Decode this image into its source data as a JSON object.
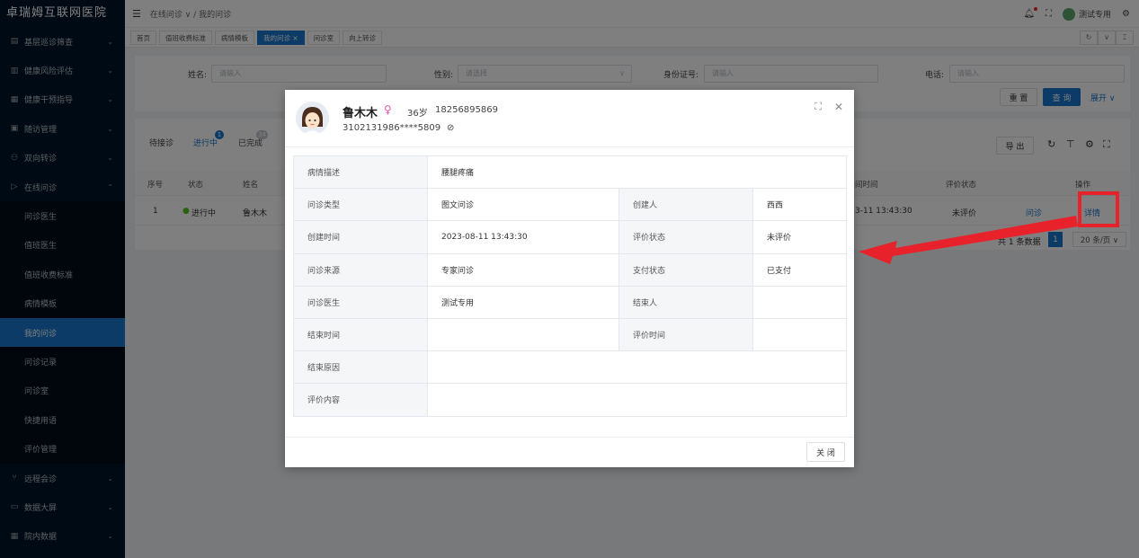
{
  "app": {
    "title": "卓瑞姆互联网医院"
  },
  "sidebar": {
    "items": [
      {
        "icon": "clipboard-icon",
        "glyph": "▤",
        "label": "基层巡诊筛查",
        "chevron": "⌄"
      },
      {
        "icon": "report-icon",
        "glyph": "▥",
        "label": "健康风险评估",
        "chevron": "⌄"
      },
      {
        "icon": "list-icon",
        "glyph": "▦",
        "label": "健康干预指导",
        "chevron": "⌄"
      },
      {
        "icon": "calendar-icon",
        "glyph": "▣",
        "label": "随访管理",
        "chevron": "⌄"
      },
      {
        "icon": "users-icon",
        "glyph": "⚇",
        "label": "双向转诊",
        "chevron": "⌄"
      },
      {
        "icon": "play-icon",
        "glyph": "▷",
        "label": "在线问诊",
        "chevron": "⌃"
      }
    ],
    "subitems": [
      "问诊医生",
      "值班医生",
      "值班收费标准",
      "病情模板",
      "我的问诊",
      "问诊记录",
      "问诊室",
      "快捷用语",
      "评价管理"
    ],
    "active_subitem": "我的问诊",
    "bottom_items": [
      {
        "icon": "branch-icon",
        "glyph": "⑂",
        "label": "远程会诊",
        "chevron": "⌄"
      },
      {
        "icon": "screen-icon",
        "glyph": "▭",
        "label": "数据大屏",
        "chevron": "⌄"
      },
      {
        "icon": "table-icon",
        "glyph": "▦",
        "label": "院内数据",
        "chevron": "⌄"
      }
    ]
  },
  "header": {
    "breadcrumb": "在线问诊 ∨  /  我的问诊",
    "user": "测试专用"
  },
  "tags": [
    {
      "label": "首页",
      "active": false
    },
    {
      "label": "值班收费标准",
      "active": false
    },
    {
      "label": "病情模板",
      "active": false
    },
    {
      "label": "我的问诊 ×",
      "active": true
    },
    {
      "label": "问诊室",
      "active": false
    },
    {
      "label": "向上转诊",
      "active": false
    }
  ],
  "search": {
    "name_label": "姓名:",
    "name_placeholder": "请输入",
    "sex_label": "性别:",
    "sex_placeholder": "请选择",
    "idcard_label": "身份证号:",
    "idcard_placeholder": "请输入",
    "phone_label": "电话:",
    "phone_placeholder": "请输入",
    "reset": "重 置",
    "query": "查 询",
    "expand": "展开 ∨"
  },
  "list": {
    "tabs": [
      {
        "label": "待接诊"
      },
      {
        "label": "进行中",
        "badge": "1"
      },
      {
        "label": "已完成",
        "badge": "34"
      }
    ],
    "export": "导 出",
    "columns": {
      "no": "序号",
      "status": "状态",
      "name": "姓名",
      "time": "间时间",
      "eval": "评价状态",
      "op": "操作"
    },
    "row": {
      "no": "1",
      "status": "进行中",
      "name": "鲁木木",
      "time": "3-11 13:43:30",
      "eval": "未评价",
      "op1": "问诊",
      "detail": "详情"
    },
    "total": "共 1 条数据",
    "page": "1",
    "page_size": "20 条/页 ∨"
  },
  "modal": {
    "name": "鲁木木",
    "sex_symbol": "♀",
    "age": "36岁",
    "phone": "18256895869",
    "idcard": "3102131986****5809",
    "close_btn": "关 闭",
    "fields": {
      "desc_k": "病情描述",
      "desc_v": "腰腿疼痛",
      "type_k": "问诊类型",
      "type_v": "图文问诊",
      "creator_k": "创建人",
      "creator_v": "西西",
      "ctime_k": "创建时间",
      "ctime_v": "2023-08-11 13:43:30",
      "eval_k": "评价状态",
      "eval_v": "未评价",
      "source_k": "问诊来源",
      "source_v": "专家问诊",
      "pay_k": "支付状态",
      "pay_v": "已支付",
      "doctor_k": "问诊医生",
      "doctor_v": "测试专用",
      "ender_k": "结束人",
      "ender_v": "",
      "etime_k": "结束时间",
      "etime_v": "",
      "evtime_k": "评价时间",
      "evtime_v": "",
      "reason_k": "结束原因",
      "reason_v": "",
      "content_k": "评价内容",
      "content_v": ""
    }
  },
  "colors": {
    "primary": "#1677cc",
    "sidebar": "#001529",
    "highlight": "#e8222b"
  }
}
